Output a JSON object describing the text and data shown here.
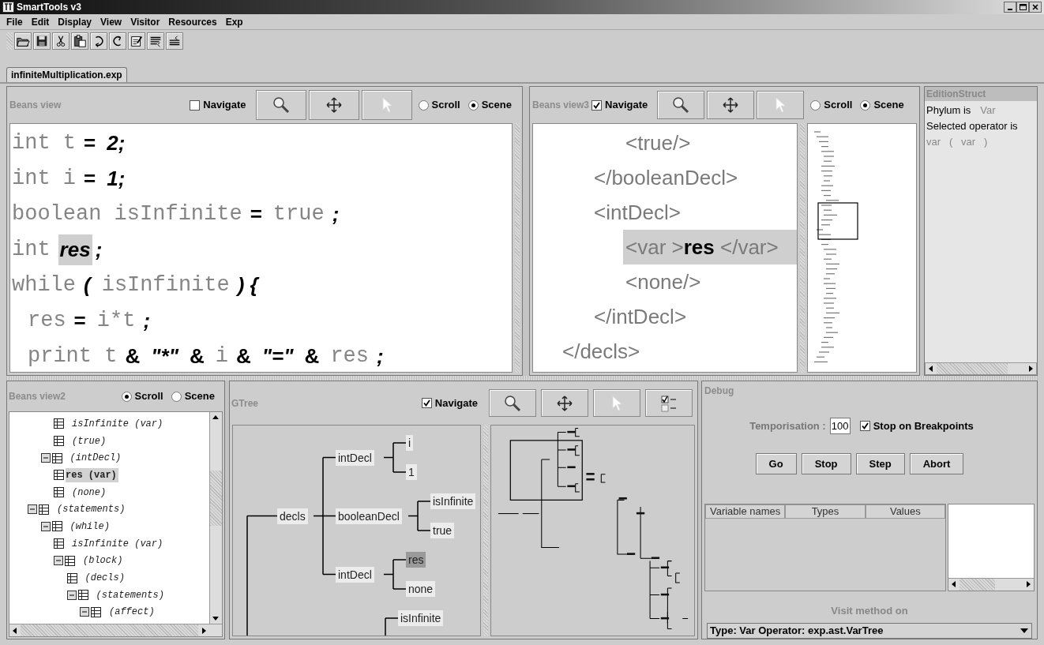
{
  "window": {
    "title": "SmartTools v3"
  },
  "menu": [
    "File",
    "Edit",
    "Display",
    "View",
    "Visitor",
    "Resources",
    "Exp"
  ],
  "tabs": [
    {
      "label": "infiniteMultiplication.exp",
      "selected": true
    }
  ],
  "beans_view": {
    "title": "Beans view",
    "navigate": {
      "label": "Navigate",
      "checked": false
    },
    "modes": [
      {
        "label": "Scroll",
        "selected": false
      },
      {
        "label": "Scene",
        "selected": true
      }
    ],
    "code_lines": [
      {
        "indented": false,
        "segments": [
          {
            "kind": "kw",
            "text": "int t"
          },
          {
            "kind": "op",
            "text": "="
          },
          {
            "kind": "lit",
            "text": "2;"
          }
        ]
      },
      {
        "indented": false,
        "segments": [
          {
            "kind": "kw",
            "text": "int i"
          },
          {
            "kind": "op",
            "text": "="
          },
          {
            "kind": "lit",
            "text": "1;"
          }
        ]
      },
      {
        "indented": false,
        "segments": [
          {
            "kind": "kw",
            "text": "boolean isInfinite"
          },
          {
            "kind": "op",
            "text": "="
          },
          {
            "kind": "kw",
            "text": "true"
          },
          {
            "kind": "lit",
            "text": ";"
          }
        ]
      },
      {
        "indented": false,
        "segments": [
          {
            "kind": "kw",
            "text": "int"
          },
          {
            "kind": "sel",
            "text": "res"
          },
          {
            "kind": "lit",
            "text": ";"
          }
        ]
      },
      {
        "indented": false,
        "segments": [
          {
            "kind": "kw",
            "text": "while"
          },
          {
            "kind": "lit",
            "text": "("
          },
          {
            "kind": "kw",
            "text": "isInfinite"
          },
          {
            "kind": "lit",
            "text": ") {"
          }
        ]
      },
      {
        "indented": true,
        "segments": [
          {
            "kind": "kw",
            "text": "res"
          },
          {
            "kind": "op",
            "text": "="
          },
          {
            "kind": "kw",
            "text": "i*t"
          },
          {
            "kind": "lit",
            "text": ";"
          }
        ]
      },
      {
        "indented": true,
        "segments": [
          {
            "kind": "kw",
            "text": "print t"
          },
          {
            "kind": "op",
            "text": "&"
          },
          {
            "kind": "lit",
            "text": "\"*\""
          },
          {
            "kind": "op",
            "text": "&"
          },
          {
            "kind": "kw",
            "text": "i"
          },
          {
            "kind": "op",
            "text": "&"
          },
          {
            "kind": "lit",
            "text": "\"=\""
          },
          {
            "kind": "op",
            "text": "&"
          },
          {
            "kind": "kw",
            "text": "res"
          },
          {
            "kind": "lit",
            "text": ";"
          }
        ]
      }
    ]
  },
  "beans_view3": {
    "title": "Beans view3",
    "navigate": {
      "label": "Navigate",
      "checked": true
    },
    "modes": [
      {
        "label": "Scroll",
        "selected": false
      },
      {
        "label": "Scene",
        "selected": true
      }
    ],
    "xml": [
      {
        "children": [
          {
            "children": [
              {
                "text": "<true/>",
                "selected": false
              }
            ]
          },
          {
            "text": "</booleanDecl>",
            "selected": false
          },
          {
            "text": "<intDecl>",
            "selected": false,
            "children": [
              {
                "text": "<var >**res** </var>",
                "selected": true
              },
              {
                "text": "<none/>",
                "selected": false
              }
            ]
          },
          {
            "text": "</intDecl>",
            "selected": false
          }
        ]
      },
      {
        "text": "</decls>",
        "selected": false
      }
    ]
  },
  "edition_struct": {
    "title": "EditionStruct",
    "lines": [
      {
        "text": "Phylum is",
        "value": "Var"
      },
      {
        "text": "Selected operator is"
      },
      {
        "value": "var   (   var   )"
      }
    ]
  },
  "beans_view2": {
    "title": "Beans view2",
    "modes": [
      {
        "label": "Scroll",
        "selected": true
      },
      {
        "label": "Scene",
        "selected": false
      }
    ],
    "tree": [
      {
        "children": [
          {
            "children": [
              {
                "label": "isInfinite (var)",
                "selected": false
              },
              {
                "label": "(true)",
                "selected": false
              }
            ]
          },
          {
            "label": "(intDecl)",
            "expanded": true,
            "selected": false,
            "children": [
              {
                "label": "res (var)",
                "selected": true
              },
              {
                "label": "(none)",
                "selected": false
              }
            ]
          }
        ]
      },
      {
        "label": "(statements)",
        "expanded": true,
        "selected": false,
        "children": [
          {
            "label": "(while)",
            "expanded": true,
            "selected": false,
            "children": [
              {
                "label": "isInfinite (var)",
                "selected": false
              },
              {
                "label": "(block)",
                "expanded": true,
                "selected": false,
                "children": [
                  {
                    "label": "(decls)",
                    "selected": false
                  },
                  {
                    "label": "(statements)",
                    "expanded": true,
                    "selected": false,
                    "children": [
                      {
                        "label": "(affect)",
                        "expanded": true,
                        "selected": false
                      }
                    ]
                  }
                ]
              }
            ]
          }
        ]
      }
    ]
  },
  "gtree": {
    "title": "GTree",
    "navigate": {
      "label": "Navigate",
      "checked": true
    },
    "nodes": [
      {
        "label": "decls",
        "selected": false,
        "children": [
          {
            "label": "intDecl",
            "selected": false,
            "children": [
              {
                "label": "i",
                "selected": false
              },
              {
                "label": "1",
                "selected": false
              }
            ]
          },
          {
            "label": "booleanDecl",
            "selected": false,
            "children": [
              {
                "label": "isInfinite",
                "selected": false
              },
              {
                "label": "true",
                "selected": false
              }
            ]
          },
          {
            "label": "intDecl",
            "selected": false,
            "children": [
              {
                "label": "res",
                "selected": true
              },
              {
                "label": "none",
                "selected": false
              }
            ]
          }
        ]
      },
      {
        "children": [
          {
            "label": "isInfinite",
            "selected": false
          }
        ]
      }
    ]
  },
  "debug": {
    "title": "Debug",
    "temporisation_label": "Temporisation :",
    "temporisation": "100",
    "breakpoints": {
      "label": "Stop on Breakpoints",
      "checked": true
    },
    "buttons": [
      "Go",
      "Stop",
      "Step",
      "Abort"
    ],
    "columns": [
      "Variable names",
      "Types",
      "Values"
    ],
    "visit_label": "Visit method on",
    "visit_method": "Type: Var Operator: exp.ast.VarTree"
  }
}
